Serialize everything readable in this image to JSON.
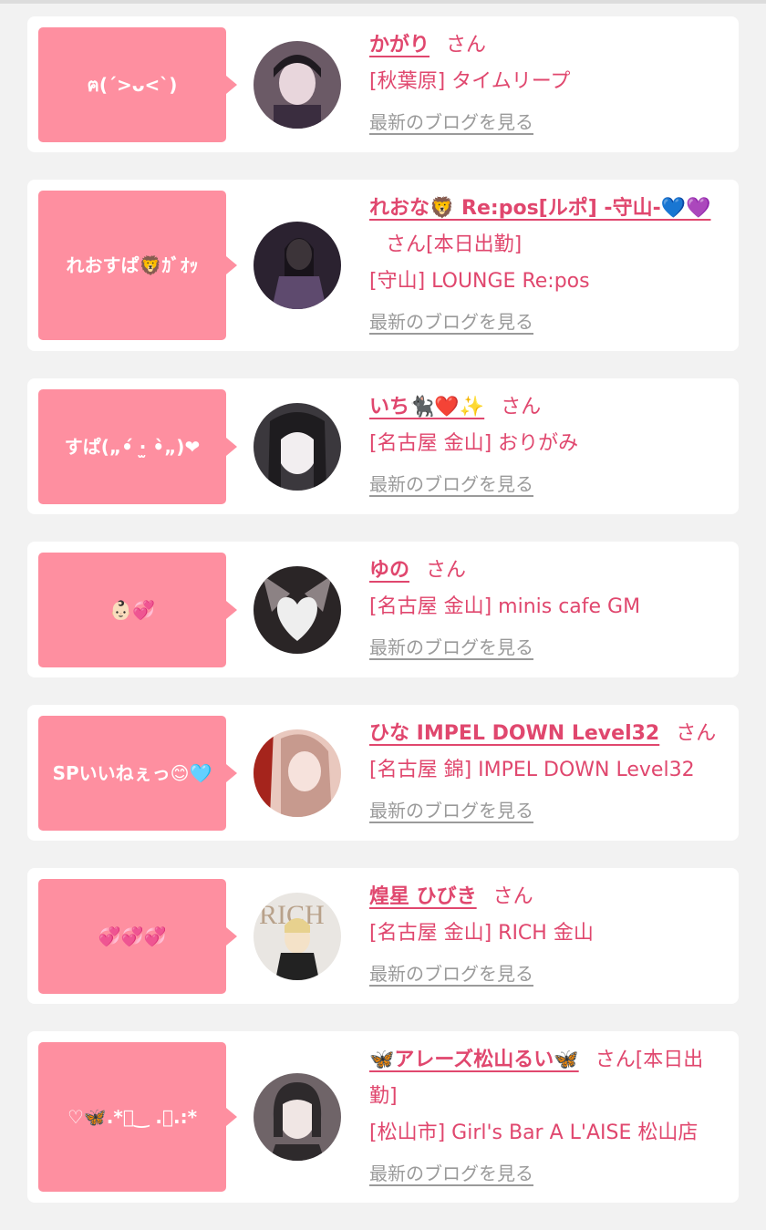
{
  "blog_link_label": "最新のブログを見る",
  "cards": [
    {
      "bubble": "ฅ(´>ᴗ<`)",
      "name": "かがり",
      "suffix": "さん",
      "shop": "[秋葉原] タイムリープ",
      "avatar_colors": [
        "#6b5a66",
        "#3a2d3f",
        "#e8d6dc"
      ]
    },
    {
      "bubble": "れおすぱ🦁ｶﾞｵｯ",
      "name": "れおな🦁 Re:pos[ルポ] -守山-💙💜",
      "suffix": "さん[本日出勤]",
      "shop": "[守山] LOUNGE Re:pos",
      "avatar_colors": [
        "#2b2230",
        "#5e4a6e",
        "#d9c2c8"
      ]
    },
    {
      "bubble": "すぱ(​„•́ ·̫ •̀„)❤",
      "name": "いち🐈‍⬛❤️✨",
      "suffix": "さん",
      "shop": "[名古屋 金山] おりがみ",
      "avatar_colors": [
        "#1e1c1f",
        "#3b383d",
        "#f2eef0"
      ]
    },
    {
      "bubble": "👶🏻💞",
      "name": "ゆの",
      "suffix": "さん",
      "shop": "[名古屋 金山] minis cafe GM",
      "avatar_colors": [
        "#2a2526",
        "#8c8284",
        "#eeeeee"
      ]
    },
    {
      "bubble": "SPいいねぇっ😊🩵",
      "name": "ひな IMPEL DOWN Level32",
      "suffix": "さん",
      "shop": "[名古屋 錦] IMPEL DOWN Level32",
      "avatar_colors": [
        "#c79a8e",
        "#e9c8be",
        "#a5241c"
      ]
    },
    {
      "bubble": "💞💞💞",
      "name": "煌星 ひびき",
      "suffix": "さん",
      "shop": "[名古屋 金山] RICH 金山",
      "avatar_colors": [
        "#e9e6e2",
        "#b8a18a",
        "#222222"
      ]
    },
    {
      "bubble": "♡🦋.*ﾟ‿ .｡.:*",
      "name": "🦋アレーズ松山るい🦋",
      "suffix": "さん[本日出勤]",
      "shop": "[松山市] Girl's Bar A L'AISE 松山店",
      "avatar_colors": [
        "#2e2a2c",
        "#6f6468",
        "#f0e6e4"
      ]
    }
  ]
}
